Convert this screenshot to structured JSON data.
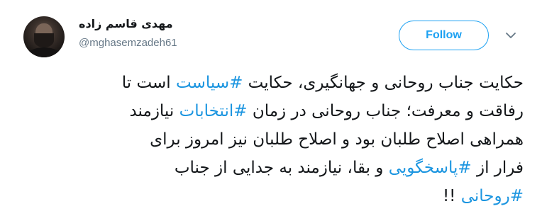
{
  "tweet": {
    "author_name": "مهدی قاسم زاده",
    "author_handle": "@mghasemzadeh61",
    "follow_label": "Follow",
    "caret_icon": "chevron-down-icon",
    "accent_color": "#1da1f2",
    "hashtag_color": "#1b95e0",
    "lines": [
      {
        "before": "حکایت جناب روحانی و جهانگیری، حکایت ",
        "tag": "#سیاست",
        "after": " است تا"
      },
      {
        "before": "رفاقت و معرفت؛ جناب روحانی در زمان ",
        "tag": "#انتخابات",
        "after": " نیازمند"
      },
      {
        "before": "همراهی اصلاح طلبان بود و اصلاح طلبان نیز امروز برای",
        "tag": "",
        "after": ""
      },
      {
        "before": "فرار از ",
        "tag": "#پاسخگویی",
        "after": " و بقا، نیازمند به جدایی از جناب"
      },
      {
        "before": "",
        "tag": "#روحانی",
        "after": " !!"
      }
    ]
  }
}
